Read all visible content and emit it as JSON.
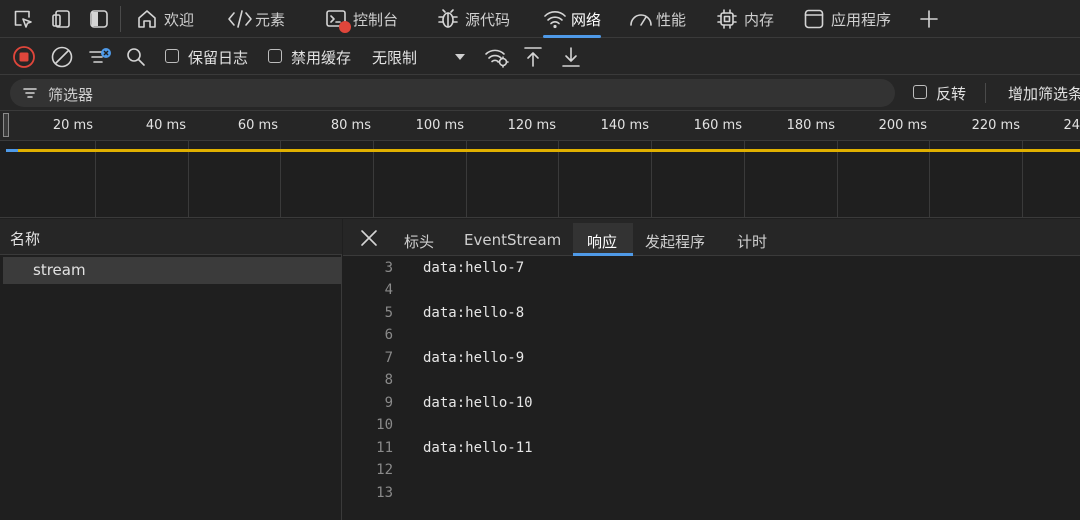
{
  "tabs": [
    {
      "label": "欢迎",
      "icon": "home-icon"
    },
    {
      "label": "元素",
      "icon": "code-brackets-icon"
    },
    {
      "label": "控制台",
      "icon": "console-icon"
    },
    {
      "label": "源代码",
      "icon": "bug-icon"
    },
    {
      "label": "网络",
      "icon": "wifi-icon",
      "active": true
    },
    {
      "label": "性能",
      "icon": "gauge-icon"
    },
    {
      "label": "内存",
      "icon": "chip-icon"
    },
    {
      "label": "应用程序",
      "icon": "app-window-icon"
    }
  ],
  "toolbar": {
    "preserve_log": "保留日志",
    "disable_cache": "禁用缓存",
    "throttling": "无限制"
  },
  "filter": {
    "placeholder": "筛选器",
    "invert": "反转",
    "more_filters": "增加筛选条"
  },
  "timeline": {
    "ticks": [
      "20 ms",
      "40 ms",
      "60 ms",
      "80 ms",
      "100 ms",
      "120 ms",
      "140 ms",
      "160 ms",
      "180 ms",
      "200 ms",
      "220 ms",
      "24"
    ]
  },
  "request_list": {
    "header": "名称",
    "items": [
      "stream"
    ]
  },
  "detail_tabs": {
    "headers": "标头",
    "event_stream": "EventStream",
    "response": "响应",
    "initiator": "发起程序",
    "timing": "计时"
  },
  "response_lines": [
    {
      "n": "3",
      "text": "data:hello-7"
    },
    {
      "n": "4",
      "text": ""
    },
    {
      "n": "5",
      "text": "data:hello-8"
    },
    {
      "n": "6",
      "text": ""
    },
    {
      "n": "7",
      "text": "data:hello-9"
    },
    {
      "n": "8",
      "text": ""
    },
    {
      "n": "9",
      "text": "data:hello-10"
    },
    {
      "n": "10",
      "text": ""
    },
    {
      "n": "11",
      "text": "data:hello-11"
    },
    {
      "n": "12",
      "text": ""
    },
    {
      "n": "13",
      "text": ""
    }
  ],
  "colors": {
    "accent": "#4f9ae8",
    "record": "#e0463b",
    "waiting": "#e0b000"
  }
}
